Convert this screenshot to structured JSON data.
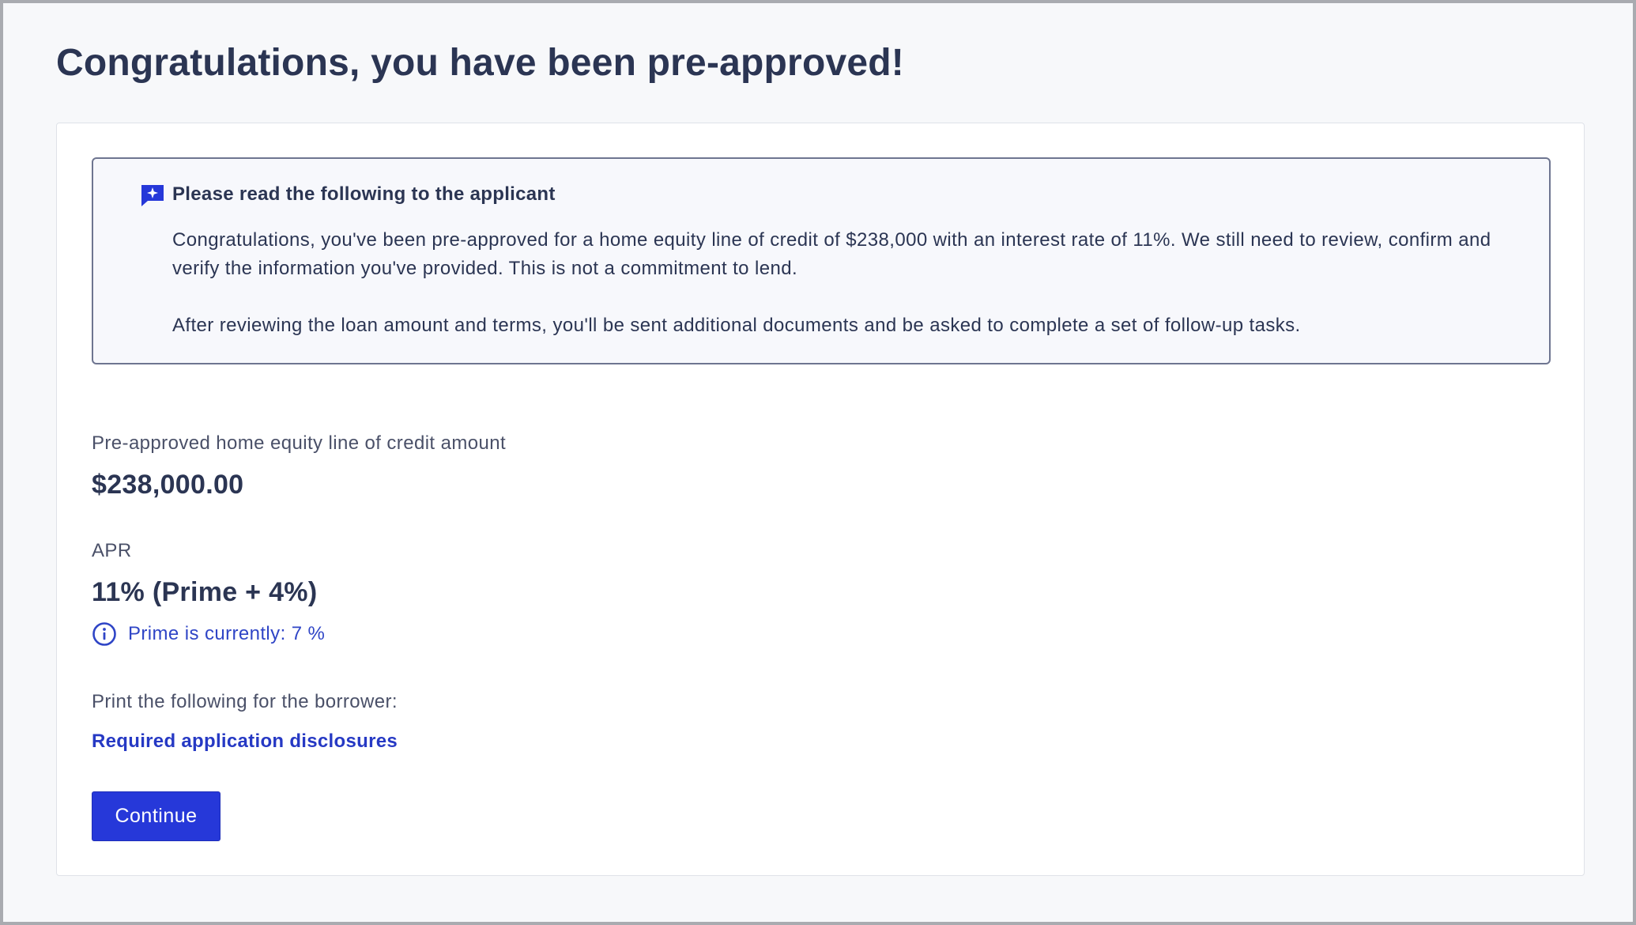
{
  "page": {
    "title": "Congratulations, you have been pre-approved!"
  },
  "script_box": {
    "icon": "chat-sparkle-icon",
    "heading": "Please read the following to the applicant",
    "paragraph_1": "Congratulations, you've been pre-approved for a home equity line of credit of $238,000 with an interest rate of 11%. We still need to review, confirm and verify the information you've provided. This is not a commitment to lend.",
    "paragraph_2": "After reviewing the loan amount and terms, you'll be sent additional documents and be asked to complete a set of follow-up tasks."
  },
  "amount": {
    "label": "Pre-approved home equity line of credit amount",
    "value": "$238,000.00"
  },
  "apr": {
    "label": "APR",
    "value": "11% (Prime + 4%)",
    "prime_note": "Prime is currently: 7 %",
    "prime_icon": "info-circle-icon"
  },
  "print": {
    "label": "Print the following for the borrower:",
    "link_text": "Required application disclosures"
  },
  "actions": {
    "continue_label": "Continue"
  },
  "colors": {
    "primary": "#2638d9",
    "link": "#2639c4",
    "text": "#2b3553",
    "page_background": "#f7f8fa"
  }
}
